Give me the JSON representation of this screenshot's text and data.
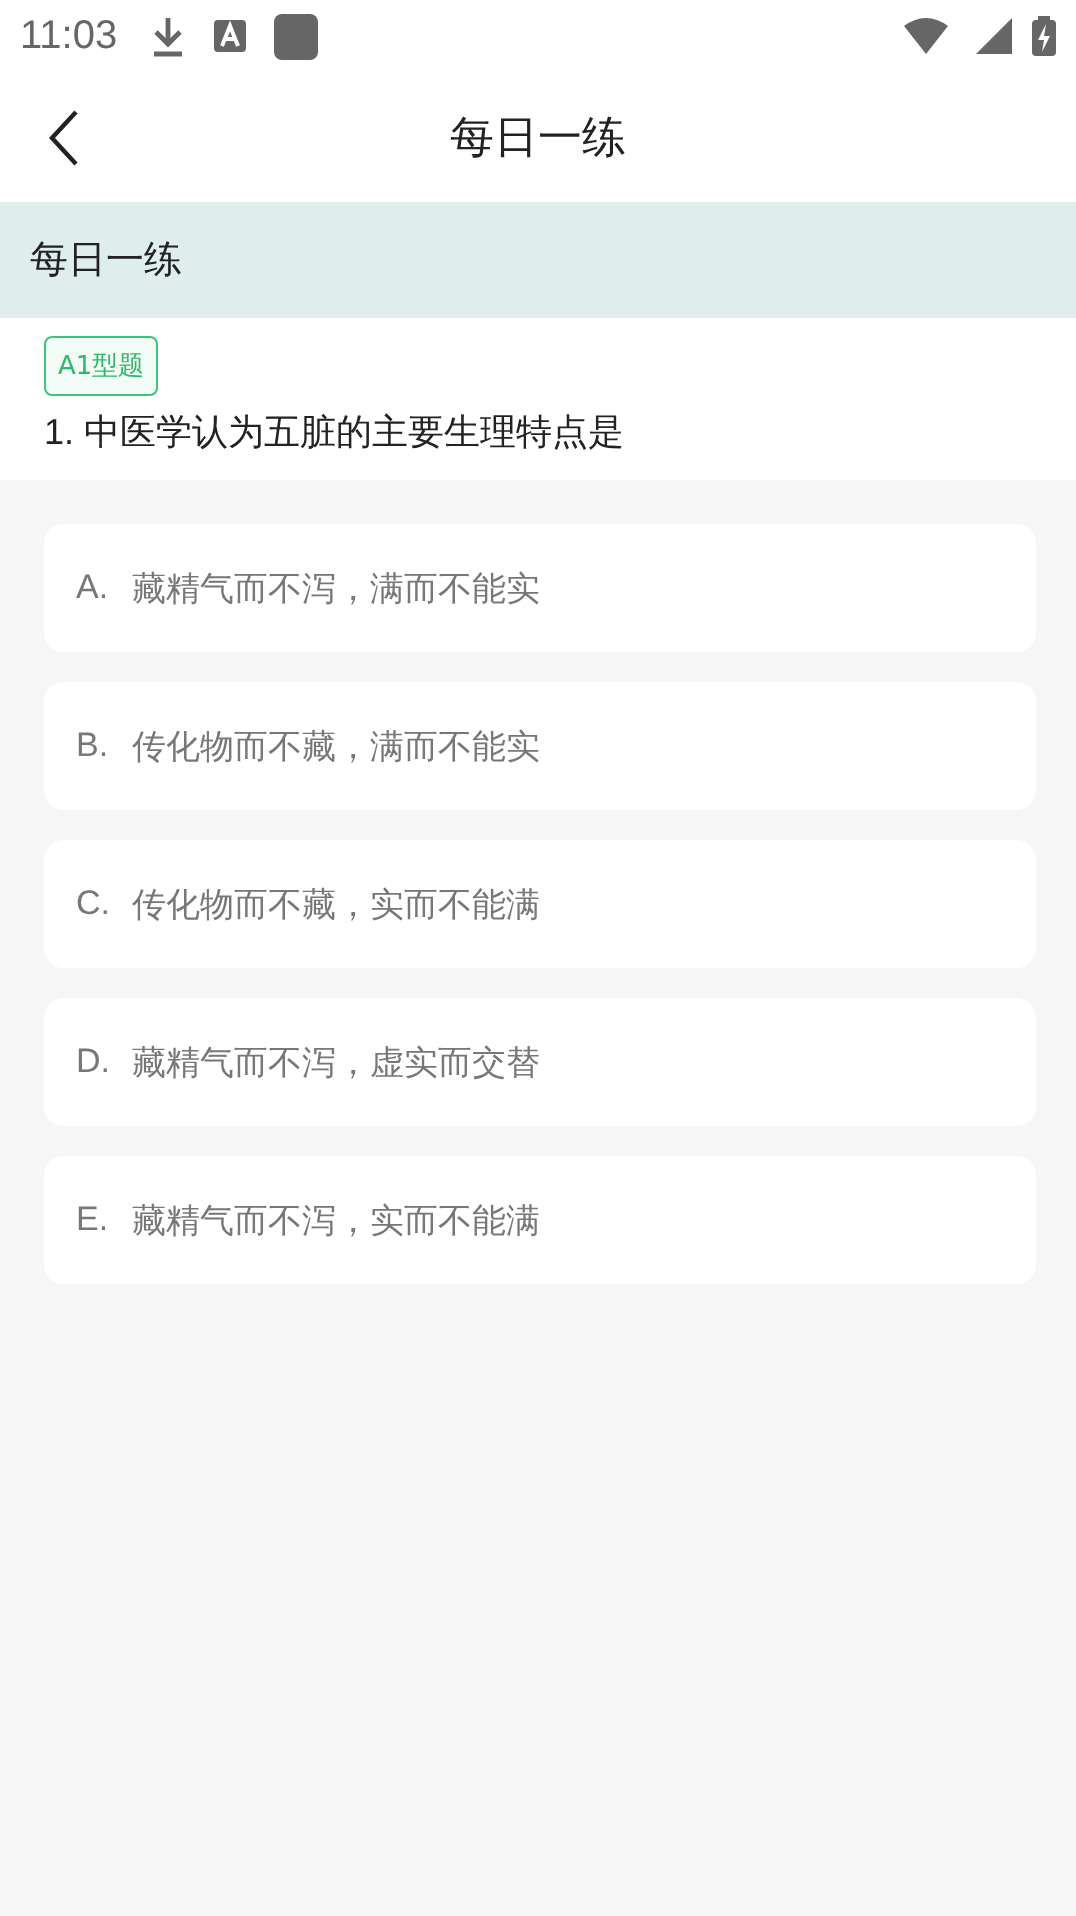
{
  "status_bar": {
    "time": "11:03"
  },
  "header": {
    "title": "每日一练"
  },
  "section": {
    "title": "每日一练"
  },
  "question": {
    "tag": "A1型题",
    "text": "1. 中医学认为五脏的主要生理特点是"
  },
  "options": [
    {
      "letter": "A.",
      "text": "藏精气而不泻，满而不能实"
    },
    {
      "letter": "B.",
      "text": "传化物而不藏，满而不能实"
    },
    {
      "letter": "C.",
      "text": "传化物而不藏，实而不能满"
    },
    {
      "letter": "D.",
      "text": "藏精气而不泻，虚实而交替"
    },
    {
      "letter": "E.",
      "text": "藏精气而不泻，实而不能满"
    }
  ]
}
